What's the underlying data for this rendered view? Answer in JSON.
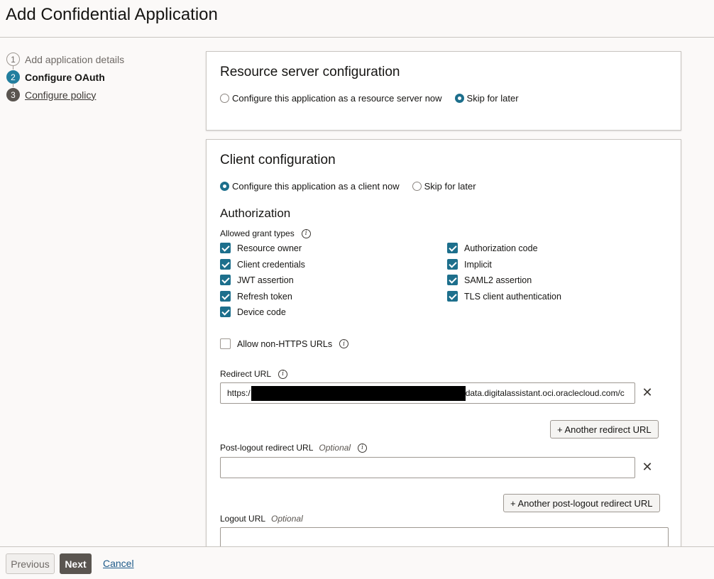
{
  "page": {
    "title": "Add Confidential Application"
  },
  "train": {
    "steps": [
      {
        "number": "1",
        "label": "Add application details",
        "state": "done"
      },
      {
        "number": "2",
        "label": "Configure OAuth",
        "state": "current"
      },
      {
        "number": "3",
        "label": "Configure policy",
        "state": "future"
      }
    ]
  },
  "resource_server": {
    "title": "Resource server configuration",
    "option_now": "Configure this application as a resource server now",
    "option_later": "Skip for later",
    "selected": "later"
  },
  "client": {
    "title": "Client configuration",
    "option_now": "Configure this application as a client now",
    "option_later": "Skip for later",
    "selected": "now",
    "authorization_title": "Authorization",
    "grant_types_label": "Allowed grant types",
    "grants_left": [
      {
        "label": "Resource owner",
        "checked": true
      },
      {
        "label": "Client credentials",
        "checked": true
      },
      {
        "label": "JWT assertion",
        "checked": true
      },
      {
        "label": "Refresh token",
        "checked": true
      },
      {
        "label": "Device code",
        "checked": true
      }
    ],
    "grants_right": [
      {
        "label": "Authorization code",
        "checked": true
      },
      {
        "label": "Implicit",
        "checked": true
      },
      {
        "label": "SAML2 assertion",
        "checked": true
      },
      {
        "label": "TLS client authentication",
        "checked": true
      }
    ],
    "allow_non_https": {
      "label": "Allow non-HTTPS URLs",
      "checked": false
    },
    "redirect_url": {
      "label": "Redirect URL",
      "value_prefix": "https:/",
      "value_suffix": "data.digitalassistant.oci.oraclecloud.com/c",
      "add_label": "+ Another redirect URL"
    },
    "post_logout": {
      "label": "Post-logout redirect URL",
      "optional": "Optional",
      "value": "",
      "add_label": "+ Another post-logout redirect URL"
    },
    "logout_url": {
      "label": "Logout URL",
      "optional": "Optional",
      "value": ""
    }
  },
  "footer": {
    "previous": "Previous",
    "next": "Next",
    "cancel": "Cancel"
  },
  "icons": {
    "info": "info-icon",
    "clear": "close-icon"
  },
  "colors": {
    "accent": "#1d6f8c",
    "next_button": "#5a5550"
  }
}
